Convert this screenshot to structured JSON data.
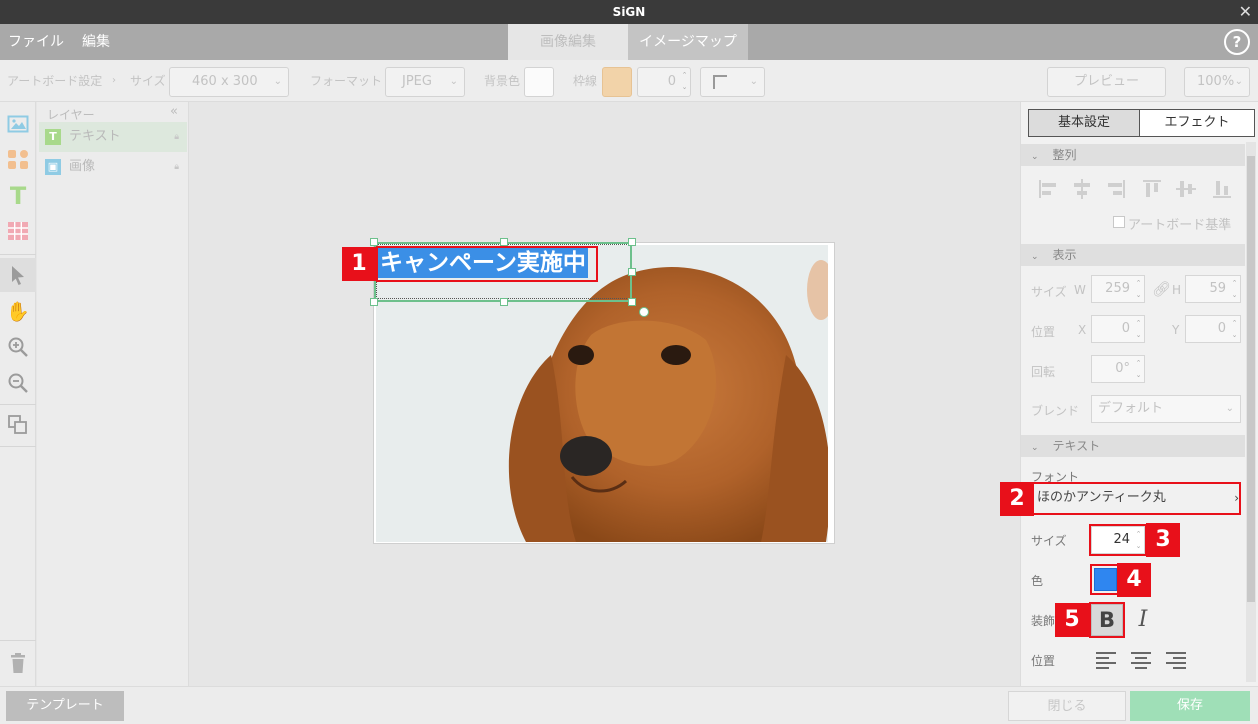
{
  "app": {
    "title": "SiGN"
  },
  "menu": {
    "file": "ファイル",
    "edit": "編集"
  },
  "tabs": {
    "image_edit": "画像編集",
    "image_map": "イメージマップ"
  },
  "toolbar": {
    "artboard_settings": "アートボード設定",
    "size_label": "サイズ",
    "size_value": "460 x 300",
    "format_label": "フォーマット",
    "format_value": "JPEG",
    "bg_label": "背景色",
    "border_label": "枠線",
    "border_width": "0",
    "preview": "プレビュー",
    "zoom": "100%"
  },
  "layers": {
    "header": "レイヤー",
    "collapse": "«",
    "items": [
      {
        "label": "テキスト",
        "badge": "T",
        "selected": true
      },
      {
        "label": "画像",
        "badge": "▣",
        "selected": false
      }
    ]
  },
  "canvas": {
    "headline": "キャンペーン実施中"
  },
  "annotations": {
    "n1": "1",
    "n2": "2",
    "n3": "3",
    "n4": "4",
    "n5": "5"
  },
  "right_panel": {
    "tabs": {
      "basic": "基本設定",
      "effect": "エフェクト"
    },
    "align": {
      "header": "整列",
      "artboard_basis": "アートボード基準"
    },
    "display": {
      "header": "表示",
      "size_label": "サイズ",
      "w_label": "W",
      "w_value": "259",
      "h_label": "H",
      "h_value": "59",
      "position_label": "位置",
      "x_label": "X",
      "x_value": "0",
      "y_label": "Y",
      "y_value": "0",
      "rotation_label": "回転",
      "rotation_value": "0°",
      "blend_label": "ブレンド",
      "blend_value": "デフォルト"
    },
    "text": {
      "header": "テキスト",
      "font_label": "フォント",
      "font_value": "ほのかアンティーク丸",
      "size_label": "サイズ",
      "size_value": "24",
      "color_label": "色",
      "color_value": "#2f86f0",
      "decoration_label": "装飾",
      "bold": "B",
      "italic": "I",
      "position_label": "位置"
    }
  },
  "bottom": {
    "template": "テンプレート",
    "close": "閉じる",
    "save": "保存"
  },
  "colors": {
    "accent_green": "#6dc08c",
    "highlight_blue": "#3b8fe6",
    "annotation_red": "#e8101a",
    "save_green": "#9fdfb7"
  }
}
